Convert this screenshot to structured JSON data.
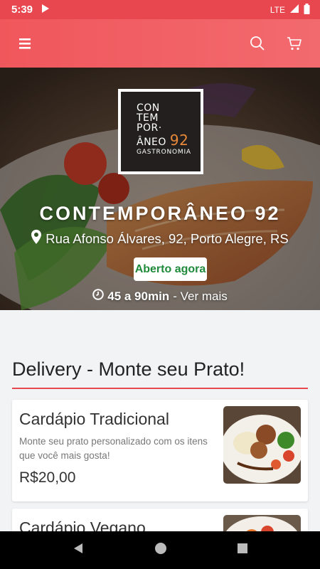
{
  "status_bar": {
    "time": "5:39",
    "network": "LTE"
  },
  "app_bar": {
    "menu_icon": "hamburger-menu-icon",
    "search_icon": "search-icon",
    "cart_icon": "cart-icon",
    "accent_color": "#f0575c"
  },
  "hero": {
    "logo": {
      "line1": "CON",
      "line2": "TEM",
      "line3": "POR·",
      "line4": "ÂNEO",
      "number": "92",
      "subtitle": "GASTRONOMIA"
    },
    "restaurant_name": "CONTEMPORÂNEO 92",
    "address": "Rua Afonso Álvares, 92, Porto Alegre, RS",
    "status_badge": "Aberto agora",
    "delivery_time": "45 a 90min",
    "see_more": " - Ver mais"
  },
  "delivery_section": {
    "title": "Delivery - Monte seu Prato!",
    "cards": [
      {
        "title": "Cardápio Tradicional",
        "description": "Monte seu prato personalizado com os itens que você mais gosta!",
        "price": "R$20,00"
      },
      {
        "title": "Cardápio Vegano"
      }
    ]
  },
  "nav_bar": {
    "back": "back-icon",
    "home": "home-icon",
    "recents": "recents-icon"
  }
}
